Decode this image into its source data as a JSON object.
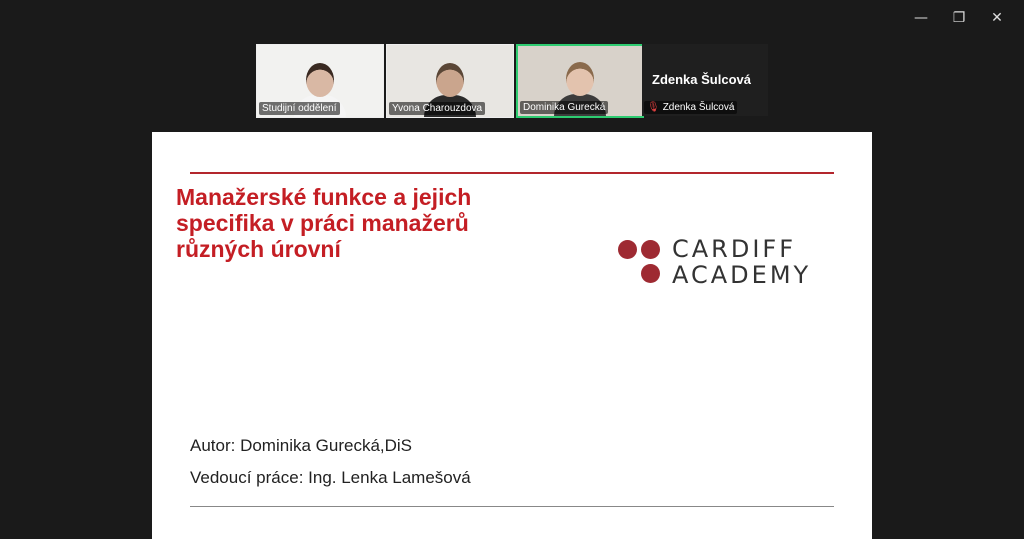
{
  "window_controls": {
    "minimize": "—",
    "restore": "❐",
    "close": "✕"
  },
  "participants": [
    {
      "name": "Studijní oddělení",
      "bg": "#f2f2f0",
      "hair": "#3a2a22",
      "skin": "#d9b8a4",
      "shirt": "#f5f5f5"
    },
    {
      "name": "Yvona Charouzdova",
      "bg": "#e8e6e2",
      "hair": "#5a4636",
      "skin": "#caa58d",
      "shirt": "#2a2a2a"
    },
    {
      "name": "Dominika Gurecká",
      "bg": "#d8d2ca",
      "hair": "#8a6a4c",
      "skin": "#e3c3ae",
      "shirt": "#3c3c3c",
      "active": true
    }
  ],
  "speaker": {
    "name_large": "Zdenka Šulcová",
    "name_small": "Zdenka Šulcová",
    "mic_icon": "mic-muted-icon"
  },
  "slide": {
    "title": "Manažerské funkce a jejich specifika v práci manažerů různých úrovní",
    "logo_line1": "CARDIFF",
    "logo_line2": "ACADEMY",
    "author": "Autor: Dominika Gurecká,DiS",
    "supervisor": "Vedoucí práce: Ing. Lenka Lamešová"
  },
  "colors": {
    "accent_red": "#c41e24",
    "logo_dot": "#9e2a32",
    "active_border": "#2ecc71"
  }
}
